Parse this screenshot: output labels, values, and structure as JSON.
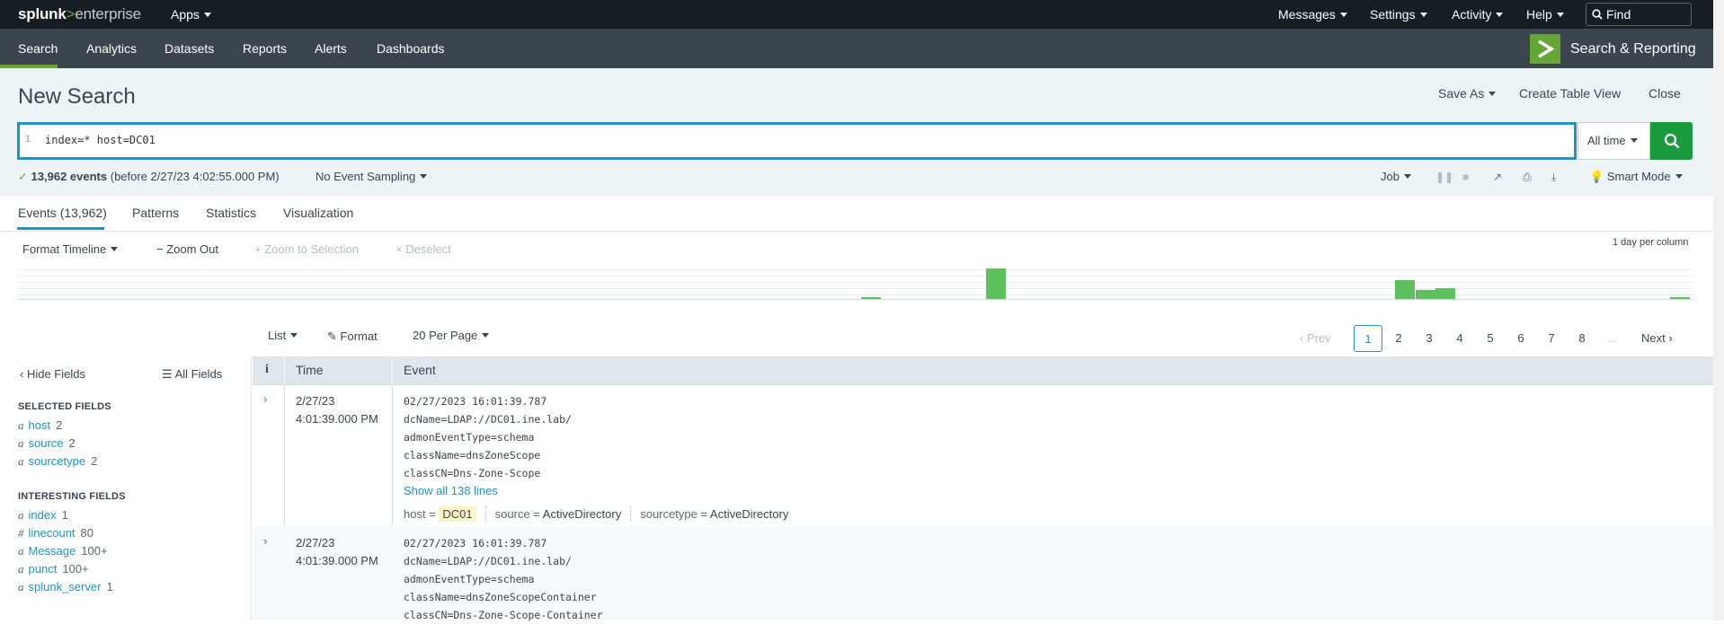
{
  "topbar": {
    "logo_brand": "splunk",
    "logo_gt": ">",
    "logo_product": "enterprise",
    "apps": "Apps",
    "messages": "Messages",
    "settings": "Settings",
    "activity": "Activity",
    "help": "Help",
    "find_placeholder": "Find"
  },
  "appbar": {
    "tabs": [
      "Search",
      "Analytics",
      "Datasets",
      "Reports",
      "Alerts",
      "Dashboards"
    ],
    "active_tab": "Search",
    "app_title": "Search & Reporting"
  },
  "header": {
    "title": "New Search",
    "save_as": "Save As",
    "create_table_view": "Create Table View",
    "close": "Close"
  },
  "search": {
    "line_number": "1",
    "query": "index=* host=DC01",
    "time_range": "All time"
  },
  "status": {
    "count": "13,962 events",
    "before": "(before 2/27/23 4:02:55.000 PM)",
    "sampling": "No Event Sampling",
    "job": "Job",
    "mode": "Smart Mode"
  },
  "result_tabs": [
    "Events (13,962)",
    "Patterns",
    "Statistics",
    "Visualization"
  ],
  "timeline": {
    "format": "Format Timeline",
    "zoom_out": "Zoom Out",
    "zoom_to_selection": "Zoom to Selection",
    "deselect": "Deselect",
    "scale": "1 day per column",
    "bars": [
      {
        "pos": 0.503,
        "h": 0.05
      },
      {
        "pos": 0.578,
        "h": 1.0
      },
      {
        "pos": 0.822,
        "h": 0.62
      },
      {
        "pos": 0.834,
        "h": 0.3
      },
      {
        "pos": 0.846,
        "h": 0.35
      },
      {
        "pos": 0.986,
        "h": 0.06
      }
    ]
  },
  "results_toolbar": {
    "list": "List",
    "format": "Format",
    "per_page": "20 Per Page",
    "prev": "Prev",
    "pages": [
      "1",
      "2",
      "3",
      "4",
      "5",
      "6",
      "7",
      "8",
      "..."
    ],
    "current_page": "1",
    "next": "Next"
  },
  "sidebar": {
    "hide_fields": "Hide Fields",
    "all_fields": "All Fields",
    "selected_heading": "SELECTED FIELDS",
    "selected": [
      {
        "type": "a",
        "name": "host",
        "count": "2"
      },
      {
        "type": "a",
        "name": "source",
        "count": "2"
      },
      {
        "type": "a",
        "name": "sourcetype",
        "count": "2"
      }
    ],
    "interesting_heading": "INTERESTING FIELDS",
    "interesting": [
      {
        "type": "a",
        "name": "index",
        "count": "1"
      },
      {
        "type": "#",
        "name": "linecount",
        "count": "80"
      },
      {
        "type": "a",
        "name": "Message",
        "count": "100+"
      },
      {
        "type": "a",
        "name": "punct",
        "count": "100+"
      },
      {
        "type": "a",
        "name": "splunk_server",
        "count": "1"
      }
    ]
  },
  "table": {
    "col_info": "i",
    "col_time": "Time",
    "col_event": "Event",
    "rows": [
      {
        "date": "2/27/23",
        "time": "4:01:39.000 PM",
        "lines": [
          "02/27/2023 16:01:39.787",
          "dcName=LDAP://DC01.ine.lab/",
          "admonEventType=schema",
          "className=dnsZoneScope",
          "classCN=Dns-Zone-Scope"
        ],
        "show_all": "Show all 138 lines",
        "host_label": "host =",
        "host": "DC01",
        "source_label": "source =",
        "source": "ActiveDirectory",
        "sourcetype_label": "sourcetype =",
        "sourcetype": "ActiveDirectory"
      },
      {
        "date": "2/27/23",
        "time": "4:01:39.000 PM",
        "lines": [
          "02/27/2023 16:01:39.787",
          "dcName=LDAP://DC01.ine.lab/",
          "admonEventType=schema",
          "className=dnsZoneScopeContainer",
          "classCN=Dns-Zone-Scope-Container"
        ]
      }
    ]
  }
}
